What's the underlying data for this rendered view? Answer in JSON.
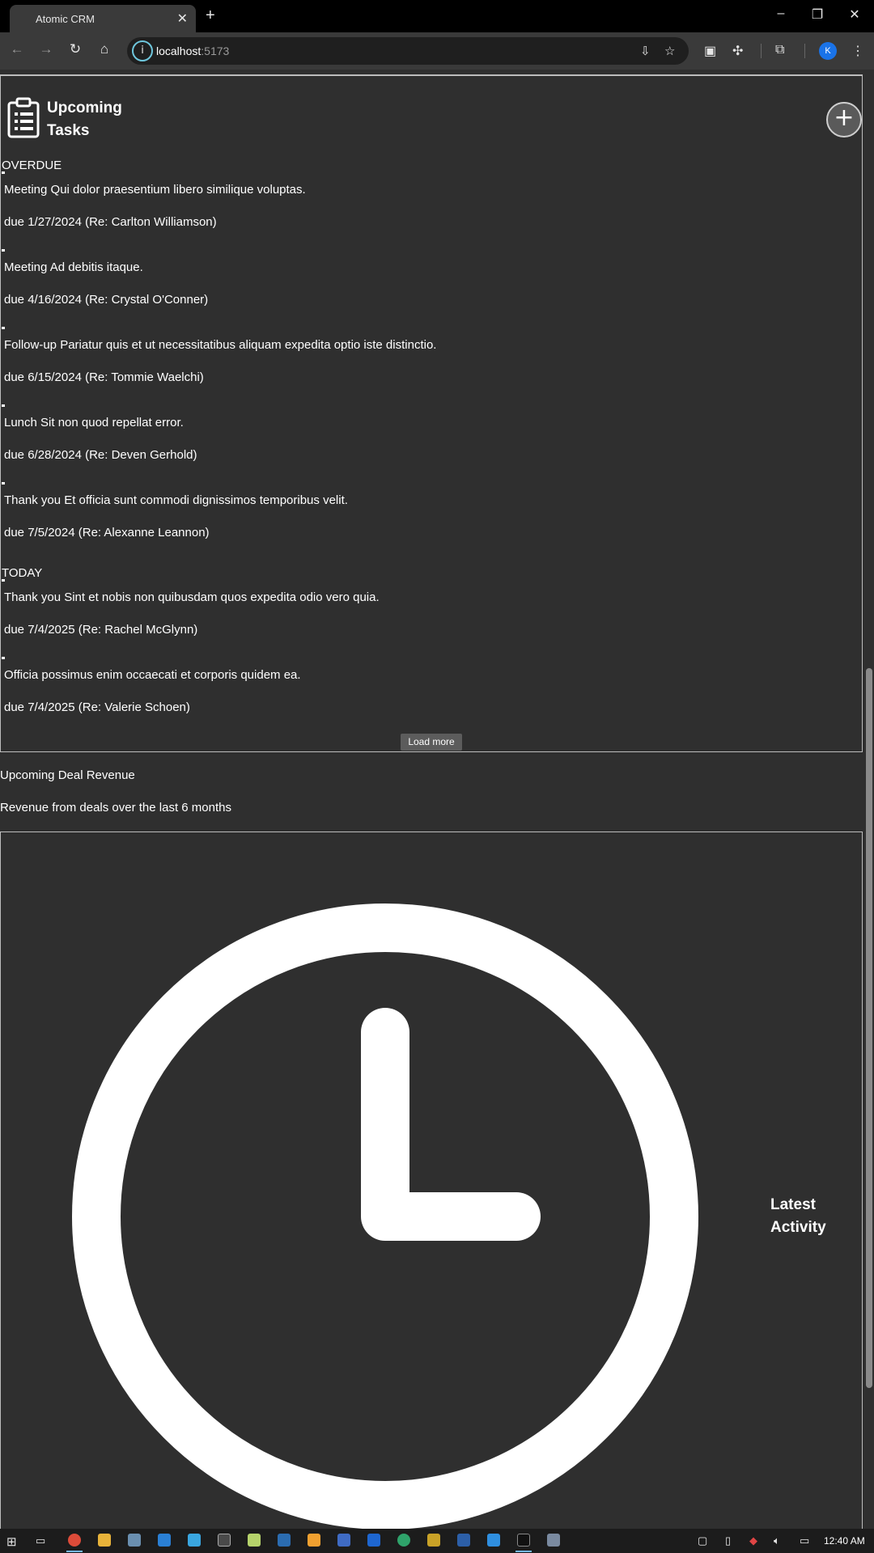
{
  "browser": {
    "tab_title": "Atomic CRM",
    "tab_close": "✕",
    "new_tab": "+",
    "url_host": "localhost",
    "url_port": ":5173",
    "profile_initial": "K",
    "window_controls": {
      "minimize": "–",
      "restore": "❐",
      "close": "✕"
    }
  },
  "tasks": {
    "title": "Upcoming Tasks",
    "add_button": "+",
    "sections": {
      "overdue": "OVERDUE",
      "today": "TODAY"
    },
    "items": [
      {
        "text": "Meeting Qui dolor praesentium libero similique voluptas.",
        "due": "due 1/27/2024 (Re: Carlton Williamson)"
      },
      {
        "text": "Meeting Ad debitis itaque.",
        "due": "due 4/16/2024 (Re: Crystal O'Conner)"
      },
      {
        "text": "Follow-up Pariatur quis et ut necessitatibus aliquam expedita optio iste distinctio.",
        "due": "due 6/15/2024 (Re: Tommie Waelchi)"
      },
      {
        "text": "Lunch Sit non quod repellat error.",
        "due": "due 6/28/2024 (Re: Deven Gerhold)"
      },
      {
        "text": "Thank you Et officia sunt commodi dignissimos temporibus velit.",
        "due": "due 7/5/2024 (Re: Alexanne Leannon)"
      },
      {
        "text": "Thank you Sint et nobis non quibusdam quos expedita odio vero quia.",
        "due": "due 7/4/2025 (Re: Rachel McGlynn)"
      },
      {
        "text": "Officia possimus enim occaecati et corporis quidem ea.",
        "due": "due 7/4/2025 (Re: Valerie Schoen)"
      }
    ],
    "load_more": "Load more"
  },
  "revenue": {
    "title": "Upcoming Deal Revenue",
    "subtitle": "Revenue from deals over the last 6 months"
  },
  "activity": {
    "title": "Latest Activity"
  },
  "taskbar": {
    "time": "12:40 AM"
  }
}
